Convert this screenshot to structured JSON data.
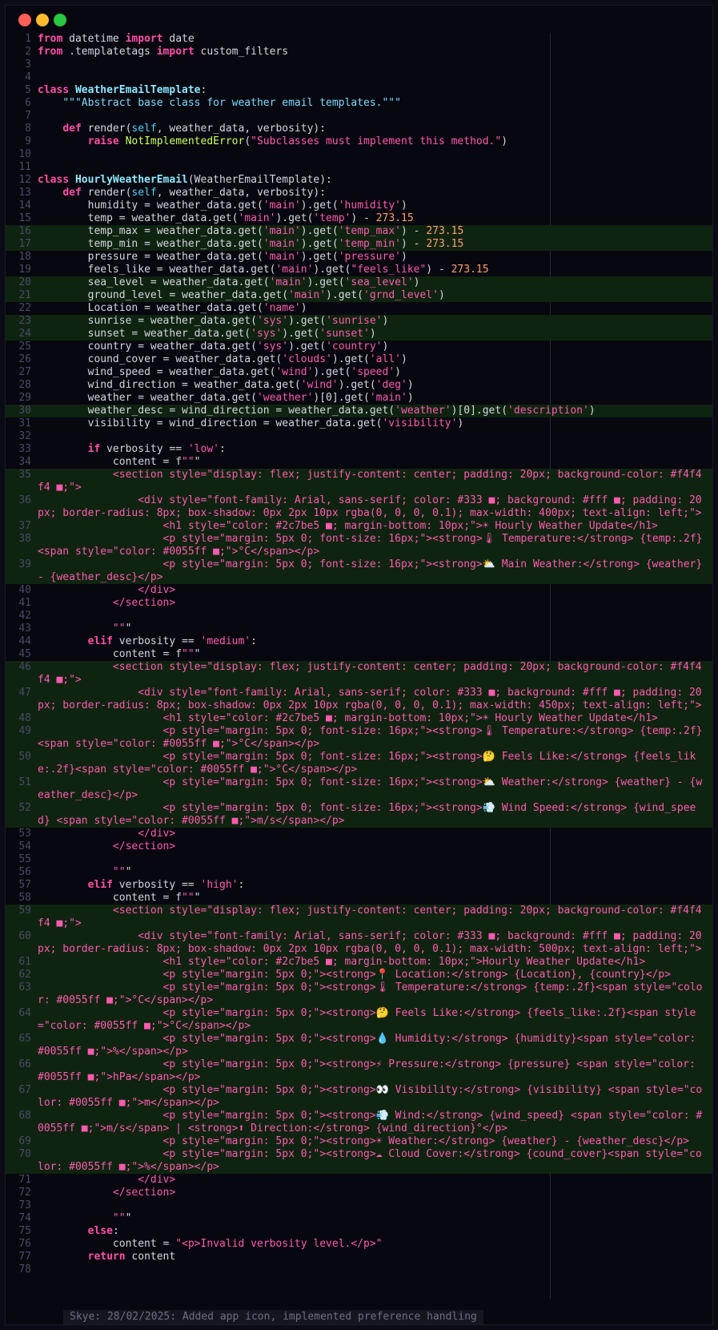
{
  "window": {
    "buttons": {
      "close_color": "#ff5f57",
      "minimize_color": "#febc2e",
      "maximize_color": "#28c840"
    }
  },
  "theme": {
    "background": "#07070f",
    "highlight_line": "#0e2410",
    "keyword": "#ff4fa8",
    "string": "#ff5ab0",
    "line_number": "#4a4a66"
  },
  "code": {
    "lines": [
      {
        "n": "1",
        "t": "from datetime import date",
        "hl": false
      },
      {
        "n": "2",
        "t": "from .templatetags import custom_filters",
        "hl": false
      },
      {
        "n": "3",
        "t": "",
        "hl": false
      },
      {
        "n": "4",
        "t": "",
        "hl": false
      },
      {
        "n": "5",
        "t": "class WeatherEmailTemplate:",
        "hl": false
      },
      {
        "n": "6",
        "t": "    \"\"\"Abstract base class for weather email templates.\"\"\"",
        "hl": false
      },
      {
        "n": "7",
        "t": "",
        "hl": false
      },
      {
        "n": "8",
        "t": "    def render(self, weather_data, verbosity):",
        "hl": false
      },
      {
        "n": "9",
        "t": "        raise NotImplementedError(\"Subclasses must implement this method.\")",
        "hl": false
      },
      {
        "n": "10",
        "t": "",
        "hl": false
      },
      {
        "n": "11",
        "t": "",
        "hl": false
      },
      {
        "n": "12",
        "t": "class HourlyWeatherEmail(WeatherEmailTemplate):",
        "hl": false
      },
      {
        "n": "13",
        "t": "    def render(self, weather_data, verbosity):",
        "hl": false
      },
      {
        "n": "14",
        "t": "        humidity = weather_data.get('main').get('humidity')",
        "hl": false
      },
      {
        "n": "15",
        "t": "        temp = weather_data.get('main').get('temp') - 273.15",
        "hl": false
      },
      {
        "n": "16",
        "t": "        temp_max = weather_data.get('main').get('temp_max') - 273.15",
        "hl": true
      },
      {
        "n": "17",
        "t": "        temp_min = weather_data.get('main').get('temp_min') - 273.15",
        "hl": true
      },
      {
        "n": "18",
        "t": "        pressure = weather_data.get('main').get('pressure')",
        "hl": false
      },
      {
        "n": "19",
        "t": "        feels_like = weather_data.get('main').get(\"feels_like\") - 273.15",
        "hl": false
      },
      {
        "n": "20",
        "t": "        sea_level = weather_data.get('main').get('sea_level')",
        "hl": true
      },
      {
        "n": "21",
        "t": "        ground_level = weather_data.get('main').get('grnd_level')",
        "hl": true
      },
      {
        "n": "22",
        "t": "        Location = weather_data.get('name')",
        "hl": false
      },
      {
        "n": "23",
        "t": "        sunrise = weather_data.get('sys').get('sunrise')",
        "hl": true
      },
      {
        "n": "24",
        "t": "        sunset = weather_data.get('sys').get('sunset')",
        "hl": true
      },
      {
        "n": "25",
        "t": "        country = weather_data.get('sys').get('country')",
        "hl": false
      },
      {
        "n": "26",
        "t": "        cound_cover = weather_data.get('clouds').get('all')",
        "hl": false
      },
      {
        "n": "27",
        "t": "        wind_speed = weather_data.get('wind').get('speed')",
        "hl": false
      },
      {
        "n": "28",
        "t": "        wind_direction = weather_data.get('wind').get('deg')",
        "hl": false
      },
      {
        "n": "29",
        "t": "        weather = weather_data.get('weather')[0].get('main')",
        "hl": false
      },
      {
        "n": "30",
        "t": "        weather_desc = wind_direction = weather_data.get('weather')[0].get('description')",
        "hl": true
      },
      {
        "n": "31",
        "t": "        visibility = wind_direction = weather_data.get('visibility')",
        "hl": false
      },
      {
        "n": "32",
        "t": "",
        "hl": false
      },
      {
        "n": "33",
        "t": "        if verbosity == 'low':",
        "hl": false
      },
      {
        "n": "34",
        "t": "            content = f\"\"\"",
        "hl": false
      },
      {
        "n": "35",
        "t": "            <section style=\"display: flex; justify-content: center; padding: 20px; background-color: #f4f4f4 ■;\">",
        "hl": true
      },
      {
        "n": "36",
        "t": "                <div style=\"font-family: Arial, sans-serif; color: #333 ■; background: #fff ■; padding: 20px; border-radius: 8px; box-shadow: 0px 2px 10px rgba(0, 0, 0, 0.1); max-width: 400px; text-align: left;\">",
        "hl": true
      },
      {
        "n": "37",
        "t": "                    <h1 style=\"color: #2c7be5 ■; margin-bottom: 10px;\">☀ Hourly Weather Update</h1>",
        "hl": true
      },
      {
        "n": "38",
        "t": "                    <p style=\"margin: 5px 0; font-size: 16px;\"><strong>🌡 Temperature:</strong> {temp:.2f}<span style=\"color: #0055ff ■;\">°C</span></p>",
        "hl": true
      },
      {
        "n": "39",
        "t": "                    <p style=\"margin: 5px 0; font-size: 16px;\"><strong>⛅ Main Weather:</strong> {weather} - {weather_desc}</p>",
        "hl": true
      },
      {
        "n": "40",
        "t": "                </div>",
        "hl": false
      },
      {
        "n": "41",
        "t": "            </section>",
        "hl": false
      },
      {
        "n": "42",
        "t": "",
        "hl": false
      },
      {
        "n": "43",
        "t": "            \"\"\"",
        "hl": false
      },
      {
        "n": "44",
        "t": "        elif verbosity == 'medium':",
        "hl": false
      },
      {
        "n": "45",
        "t": "            content = f\"\"\"",
        "hl": false
      },
      {
        "n": "46",
        "t": "            <section style=\"display: flex; justify-content: center; padding: 20px; background-color: #f4f4f4 ■;\">",
        "hl": true
      },
      {
        "n": "47",
        "t": "                <div style=\"font-family: Arial, sans-serif; color: #333 ■; background: #fff ■; padding: 20px; border-radius: 8px; box-shadow: 0px 2px 10px rgba(0, 0, 0, 0.1); max-width: 450px; text-align: left;\">",
        "hl": true
      },
      {
        "n": "48",
        "t": "                    <h1 style=\"color: #2c7be5 ■; margin-bottom: 10px;\">☀ Hourly Weather Update</h1>",
        "hl": true
      },
      {
        "n": "49",
        "t": "                    <p style=\"margin: 5px 0; font-size: 16px;\"><strong>🌡 Temperature:</strong> {temp:.2f}<span style=\"color: #0055ff ■;\">°C</span></p>",
        "hl": true
      },
      {
        "n": "50",
        "t": "                    <p style=\"margin: 5px 0; font-size: 16px;\"><strong>🤔 Feels Like:</strong> {feels_like:.2f}<span style=\"color: #0055ff ■;\">°C</span></p>",
        "hl": true
      },
      {
        "n": "51",
        "t": "                    <p style=\"margin: 5px 0; font-size: 16px;\"><strong>⛅ Weather:</strong> {weather} - {weather_desc}</p>",
        "hl": true
      },
      {
        "n": "52",
        "t": "                    <p style=\"margin: 5px 0; font-size: 16px;\"><strong>💨 Wind Speed:</strong> {wind_speed} <span style=\"color: #0055ff ■;\">m/s</span></p>",
        "hl": true
      },
      {
        "n": "53",
        "t": "                </div>",
        "hl": false
      },
      {
        "n": "54",
        "t": "            </section>",
        "hl": false
      },
      {
        "n": "55",
        "t": "",
        "hl": false
      },
      {
        "n": "56",
        "t": "            \"\"\"",
        "hl": false
      },
      {
        "n": "57",
        "t": "        elif verbosity == 'high':",
        "hl": false
      },
      {
        "n": "58",
        "t": "            content = f\"\"\"",
        "hl": false
      },
      {
        "n": "59",
        "t": "            <section style=\"display: flex; justify-content: center; padding: 20px; background-color: #f4f4f4 ■;\">",
        "hl": true
      },
      {
        "n": "60",
        "t": "                <div style=\"font-family: Arial, sans-serif; color: #333 ■; background: #fff ■; padding: 20px; border-radius: 8px; box-shadow: 0px 2px 10px rgba(0, 0, 0, 0.1); max-width: 500px; text-align: left;\">",
        "hl": true
      },
      {
        "n": "61",
        "t": "                    <h1 style=\"color: #2c7be5 ■; margin-bottom: 10px;\">Hourly Weather Update</h1>",
        "hl": true
      },
      {
        "n": "62",
        "t": "                    <p style=\"margin: 5px 0;\"><strong>📍 Location:</strong> {Location}, {country}</p>",
        "hl": true
      },
      {
        "n": "63",
        "t": "                    <p style=\"margin: 5px 0;\"><strong>🌡 Temperature:</strong> {temp:.2f}<span style=\"color: #0055ff ■;\">°C</span></p>",
        "hl": true
      },
      {
        "n": "64",
        "t": "                    <p style=\"margin: 5px 0;\"><strong>🤔 Feels Like:</strong> {feels_like:.2f}<span style=\"color: #0055ff ■;\">°C</span></p>",
        "hl": true
      },
      {
        "n": "65",
        "t": "                    <p style=\"margin: 5px 0;\"><strong>💧 Humidity:</strong> {humidity}<span style=\"color: #0055ff ■;\">%</span></p>",
        "hl": true
      },
      {
        "n": "66",
        "t": "                    <p style=\"margin: 5px 0;\"><strong>⚡ Pressure:</strong> {pressure} <span style=\"color: #0055ff ■;\">hPa</span></p>",
        "hl": true
      },
      {
        "n": "67",
        "t": "                    <p style=\"margin: 5px 0;\"><strong>👀 Visibility:</strong> {visibility} <span style=\"color: #0055ff ■;\">m</span></p>",
        "hl": true
      },
      {
        "n": "68",
        "t": "                    <p style=\"margin: 5px 0;\"><strong>💨 Wind:</strong> {wind_speed} <span style=\"color: #0055ff ■;\">m/s</span> | <strong>⬆ Direction:</strong> {wind_direction}°</p>",
        "hl": true
      },
      {
        "n": "69",
        "t": "                    <p style=\"margin: 5px 0;\"><strong>☀ Weather:</strong> {weather} - {weather_desc}</p>",
        "hl": true
      },
      {
        "n": "70",
        "t": "                    <p style=\"margin: 5px 0;\"><strong>☁ Cloud Cover:</strong> {cound_cover}<span style=\"color: #0055ff ■;\">%</span></p>",
        "hl": true
      },
      {
        "n": "71",
        "t": "                </div>",
        "hl": false
      },
      {
        "n": "72",
        "t": "            </section>",
        "hl": false
      },
      {
        "n": "73",
        "t": "",
        "hl": false
      },
      {
        "n": "74",
        "t": "            \"\"\"",
        "hl": false
      },
      {
        "n": "75",
        "t": "        else:",
        "hl": false
      },
      {
        "n": "76",
        "t": "            content = \"<p>Invalid verbosity level.</p>\"",
        "hl": false
      },
      {
        "n": "77",
        "t": "        return content",
        "hl": false
      },
      {
        "n": "78",
        "t": "",
        "hl": false
      }
    ]
  },
  "status_bar": {
    "blame": "Skye: 28/02/2025: Added app icon, implemented preference handling"
  }
}
